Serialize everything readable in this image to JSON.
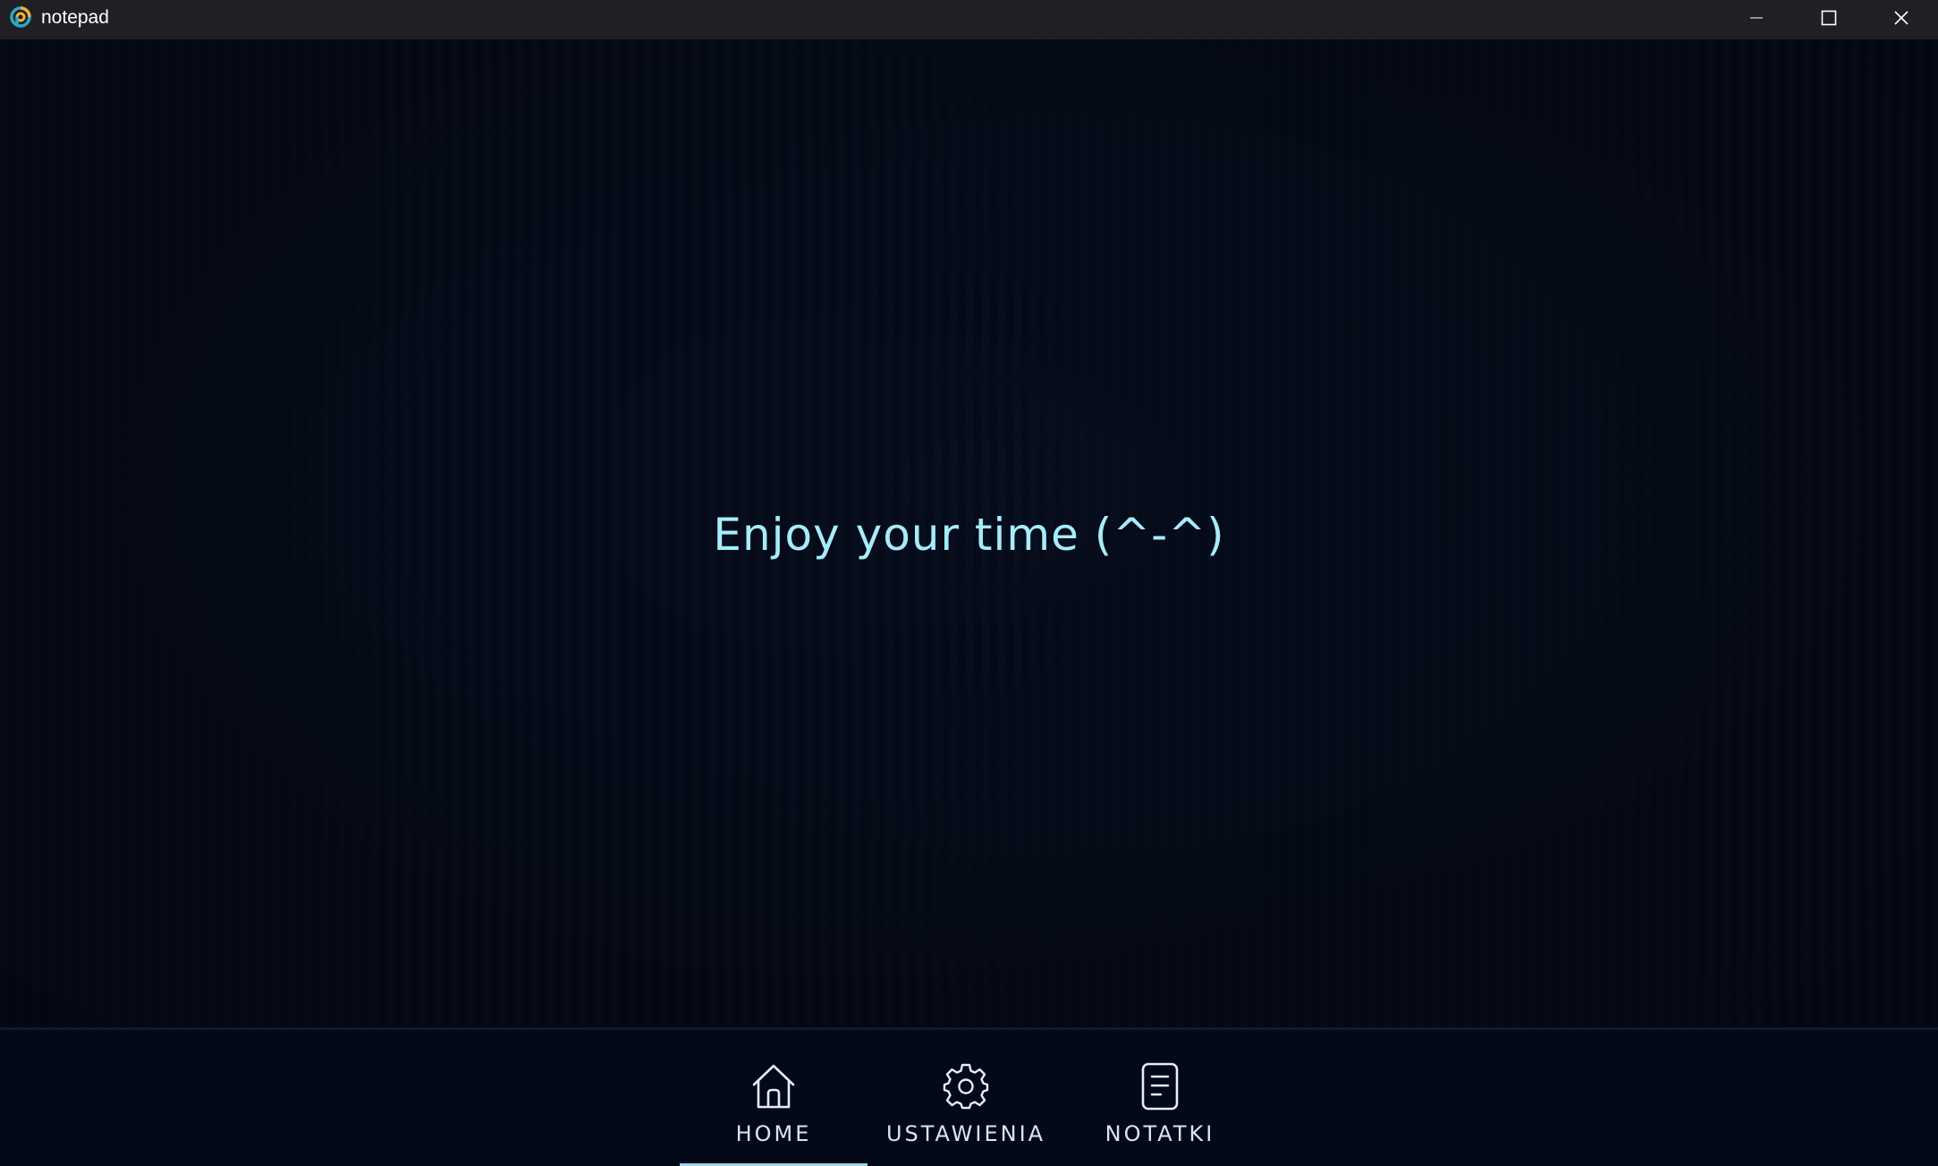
{
  "window": {
    "title": "notepad",
    "controls": {
      "minimize_icon": "minimize-icon",
      "maximize_icon": "maximize-icon",
      "close_icon": "close-icon"
    }
  },
  "main": {
    "message": "Enjoy your time (^-^)",
    "message_color": "#a6ecfb",
    "background_color": "#030713"
  },
  "nav": {
    "active": "home",
    "accent_color": "#9fd4e6",
    "items": [
      {
        "id": "home",
        "label": "HOME",
        "icon": "home-icon"
      },
      {
        "id": "settings",
        "label": "USTAWIENIA",
        "icon": "gear-icon"
      },
      {
        "id": "notes",
        "label": "NOTATKI",
        "icon": "document-icon"
      }
    ]
  }
}
